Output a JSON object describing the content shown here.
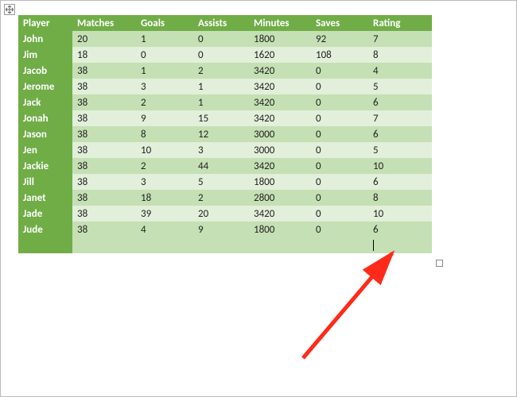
{
  "chart_data": {
    "type": "table",
    "columns": [
      "Player",
      "Matches",
      "Goals",
      "Assists",
      "Minutes",
      "Saves",
      "Rating"
    ],
    "rows": [
      [
        "John",
        20,
        1,
        0,
        1800,
        92,
        7
      ],
      [
        "Jim",
        18,
        0,
        0,
        1620,
        108,
        8
      ],
      [
        "Jacob",
        38,
        1,
        2,
        3420,
        0,
        4
      ],
      [
        "Jerome",
        38,
        3,
        1,
        3420,
        0,
        5
      ],
      [
        "Jack",
        38,
        2,
        1,
        3420,
        0,
        6
      ],
      [
        "Jonah",
        38,
        9,
        15,
        3420,
        0,
        7
      ],
      [
        "Jason",
        38,
        8,
        12,
        3000,
        0,
        6
      ],
      [
        "Jen",
        38,
        10,
        3,
        3000,
        0,
        5
      ],
      [
        "Jackie",
        38,
        2,
        44,
        3420,
        0,
        10
      ],
      [
        "Jill",
        38,
        3,
        5,
        1800,
        0,
        6
      ],
      [
        "Janet",
        38,
        18,
        2,
        2800,
        0,
        8
      ],
      [
        "Jade",
        38,
        39,
        20,
        3420,
        0,
        10
      ],
      [
        "Jude",
        38,
        4,
        9,
        1800,
        0,
        6
      ]
    ]
  },
  "headers": {
    "c0": "Player",
    "c1": "Matches",
    "c2": "Goals",
    "c3": "Assists",
    "c4": "Minutes",
    "c5": "Saves",
    "c6": "Rating"
  },
  "rows": {
    "r0": {
      "name": "John",
      "matches": "20",
      "goals": "1",
      "assists": "0",
      "minutes": "1800",
      "saves": "92",
      "rating": "7"
    },
    "r1": {
      "name": "Jim",
      "matches": "18",
      "goals": "0",
      "assists": "0",
      "minutes": "1620",
      "saves": "108",
      "rating": "8"
    },
    "r2": {
      "name": "Jacob",
      "matches": "38",
      "goals": "1",
      "assists": "2",
      "minutes": "3420",
      "saves": "0",
      "rating": "4"
    },
    "r3": {
      "name": "Jerome",
      "matches": "38",
      "goals": "3",
      "assists": "1",
      "minutes": "3420",
      "saves": "0",
      "rating": "5"
    },
    "r4": {
      "name": "Jack",
      "matches": "38",
      "goals": "2",
      "assists": "1",
      "minutes": "3420",
      "saves": "0",
      "rating": "6"
    },
    "r5": {
      "name": "Jonah",
      "matches": "38",
      "goals": "9",
      "assists": "15",
      "minutes": "3420",
      "saves": "0",
      "rating": "7"
    },
    "r6": {
      "name": "Jason",
      "matches": "38",
      "goals": "8",
      "assists": "12",
      "minutes": "3000",
      "saves": "0",
      "rating": "6"
    },
    "r7": {
      "name": "Jen",
      "matches": "38",
      "goals": "10",
      "assists": "3",
      "minutes": "3000",
      "saves": "0",
      "rating": "5"
    },
    "r8": {
      "name": "Jackie",
      "matches": "38",
      "goals": "2",
      "assists": "44",
      "minutes": "3420",
      "saves": "0",
      "rating": "10"
    },
    "r9": {
      "name": "Jill",
      "matches": "38",
      "goals": "3",
      "assists": "5",
      "minutes": "1800",
      "saves": "0",
      "rating": "6"
    },
    "r10": {
      "name": "Janet",
      "matches": "38",
      "goals": "18",
      "assists": "2",
      "minutes": "2800",
      "saves": "0",
      "rating": "8"
    },
    "r11": {
      "name": "Jade",
      "matches": "38",
      "goals": "39",
      "assists": "20",
      "minutes": "3420",
      "saves": "0",
      "rating": "10"
    },
    "r12": {
      "name": "Jude",
      "matches": "38",
      "goals": "4",
      "assists": "9",
      "minutes": "1800",
      "saves": "0",
      "rating": "6"
    }
  },
  "annotation": {
    "arrow_color": "#FF2A1A"
  }
}
